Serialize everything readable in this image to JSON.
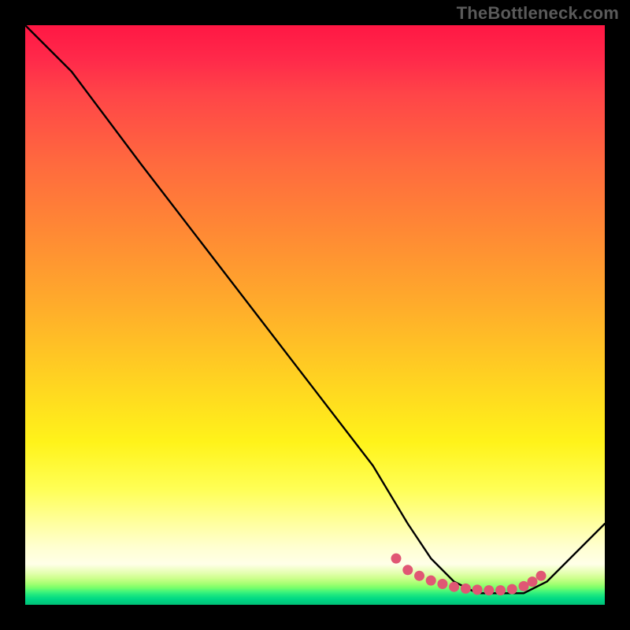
{
  "watermark": "TheBottleneck.com",
  "chart_data": {
    "type": "line",
    "title": "",
    "xlabel": "",
    "ylabel": "",
    "xlim": [
      0,
      100
    ],
    "ylim": [
      0,
      100
    ],
    "grid": false,
    "legend": false,
    "series": [
      {
        "name": "bottleneck-curve",
        "x": [
          0,
          8,
          20,
          30,
          40,
          50,
          60,
          66,
          70,
          74,
          78,
          82,
          86,
          90,
          100
        ],
        "y": [
          100,
          92,
          76,
          63,
          50,
          37,
          24,
          14,
          8,
          4,
          2,
          2,
          2,
          4,
          14
        ]
      }
    ],
    "highlight_dots": {
      "name": "flat-minimum-dots",
      "color": "#e05774",
      "x": [
        64,
        66,
        68,
        70,
        72,
        74,
        76,
        78,
        80,
        82,
        84,
        86,
        87.5,
        89
      ],
      "y": [
        8,
        6,
        5,
        4.2,
        3.6,
        3.1,
        2.8,
        2.6,
        2.5,
        2.5,
        2.7,
        3.2,
        4.0,
        5.0
      ]
    },
    "background": {
      "type": "vertical-gradient",
      "stops": [
        {
          "pos": 0.0,
          "color": "#ff1744"
        },
        {
          "pos": 0.36,
          "color": "#ff8a34"
        },
        {
          "pos": 0.72,
          "color": "#fff31a"
        },
        {
          "pos": 0.93,
          "color": "#ffffe8"
        },
        {
          "pos": 1.0,
          "color": "#00c078"
        }
      ]
    }
  }
}
